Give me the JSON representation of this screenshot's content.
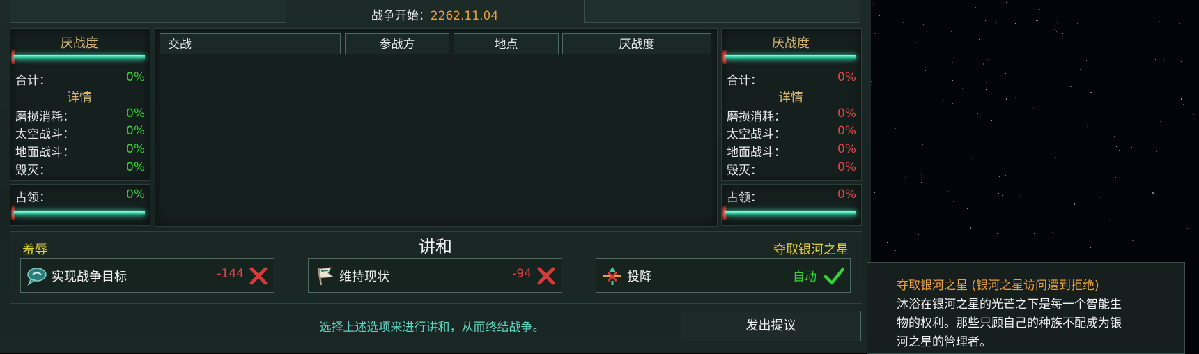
{
  "header": {
    "war_start_label": "战争开始：",
    "war_start_date": "2262.11.04"
  },
  "left_side": {
    "war_weariness_title": "厌战度",
    "total_label": "合计：",
    "total_value": "0%",
    "details_title": "详情",
    "rows": [
      {
        "label": "磨损消耗：",
        "value": "0%"
      },
      {
        "label": "太空战斗：",
        "value": "0%"
      },
      {
        "label": "地面战斗：",
        "value": "0%"
      },
      {
        "label": "毁灭：",
        "value": "0%"
      }
    ],
    "occupation_label": "占领：",
    "occupation_value": "0%"
  },
  "right_side": {
    "war_weariness_title": "厌战度",
    "total_label": "合计：",
    "total_value": "0%",
    "details_title": "详情",
    "rows": [
      {
        "label": "磨损消耗：",
        "value": "0%"
      },
      {
        "label": "太空战斗：",
        "value": "0%"
      },
      {
        "label": "地面战斗：",
        "value": "0%"
      },
      {
        "label": "毁灭：",
        "value": "0%"
      }
    ],
    "occupation_label": "占领：",
    "occupation_value": "0%"
  },
  "battles_table": {
    "columns": [
      "交战",
      "参战方",
      "地点",
      "厌战度"
    ],
    "rows": []
  },
  "peace": {
    "title": "讲和",
    "left_tag": "羞辱",
    "right_tag": "夺取银河之星",
    "options": [
      {
        "label": "实现战争目标",
        "cost": "-144",
        "icon": "speech-bubble-icon",
        "status": "x"
      },
      {
        "label": "维持现状",
        "cost": "-94",
        "icon": "white-flag-icon",
        "status": "x"
      },
      {
        "label": "投降",
        "cost": "自动",
        "icon": "surrender-icon",
        "status": "check"
      }
    ],
    "hint": "选择上述选项来进行讲和，从而终结战争。",
    "propose_button": "发出提议"
  },
  "tooltip": {
    "title": "夺取银河之星 (银河之星访问遭到拒绝)",
    "lines": [
      "沐浴在银河之星的光芒之下是每一个智能生",
      "物的权利。那些只顾自己的种族不配成为银",
      "河之星的管理者。"
    ]
  },
  "colors": {
    "accent_gold": "#e8a23a",
    "positive": "#35d035",
    "negative": "#e04545",
    "tag_yellow": "#e6d23a"
  }
}
